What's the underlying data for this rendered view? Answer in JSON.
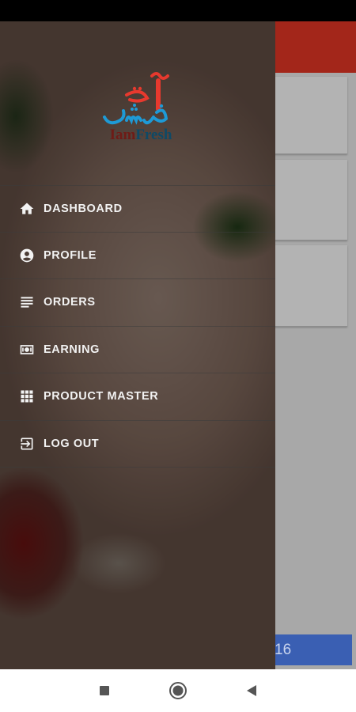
{
  "app": {
    "toolbar_color": "#a3261a",
    "bottom_button_text": "16",
    "bottom_button_color": "#3a5fb3"
  },
  "logo": {
    "urdu_text": "آئی ایم فریش",
    "latin_prefix": "Iam",
    "latin_suffix": "Fresh",
    "colors": {
      "red": "#e7392e",
      "blue": "#1e9ad6"
    }
  },
  "menu": {
    "items": [
      {
        "label": "DASHBOARD",
        "icon": "home-icon"
      },
      {
        "label": "PROFILE",
        "icon": "account-circle-icon"
      },
      {
        "label": "ORDERS",
        "icon": "list-icon"
      },
      {
        "label": "EARNING",
        "icon": "money-icon"
      },
      {
        "label": "PRODUCT MASTER",
        "icon": "grid-icon"
      },
      {
        "label": "LOG OUT",
        "icon": "logout-icon"
      }
    ]
  },
  "nav": {
    "icons": [
      "recent-apps-icon",
      "home-circle-icon",
      "back-icon"
    ]
  }
}
